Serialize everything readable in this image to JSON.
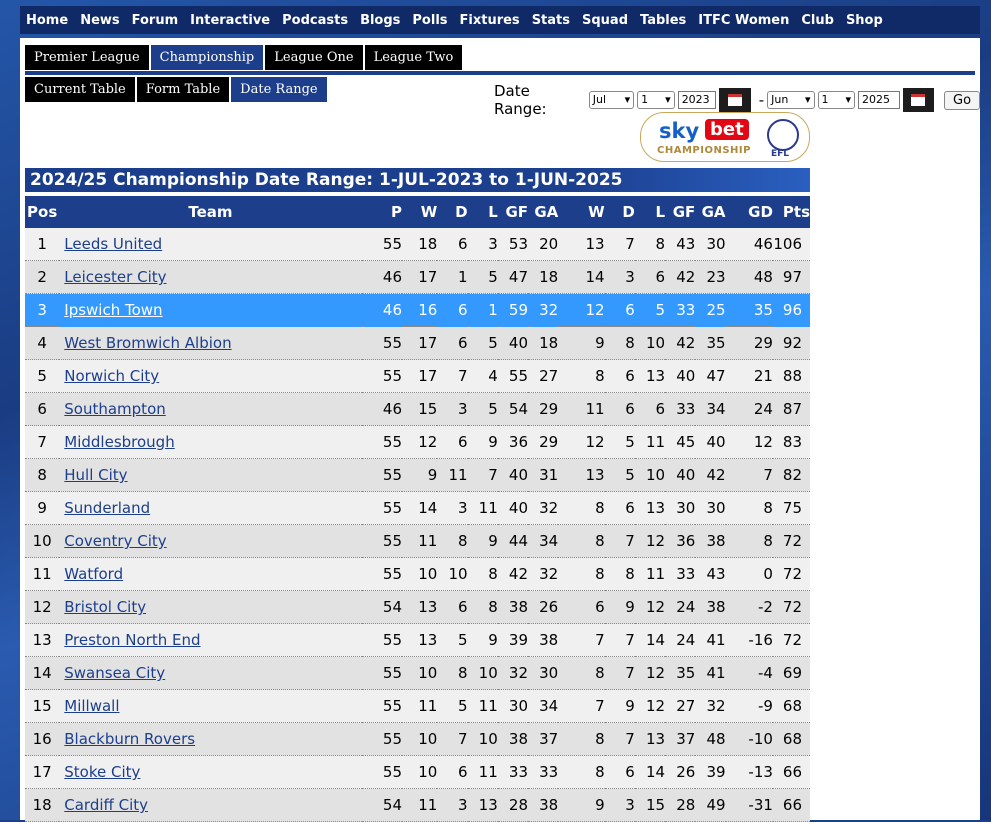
{
  "nav": [
    "Home",
    "News",
    "Forum",
    "Interactive",
    "Podcasts",
    "Blogs",
    "Polls",
    "Fixtures",
    "Stats",
    "Squad",
    "Tables",
    "ITFC Women",
    "Club",
    "Shop"
  ],
  "league_tabs": [
    {
      "label": "Premier League",
      "active": false
    },
    {
      "label": "Championship",
      "active": true
    },
    {
      "label": "League One",
      "active": false
    },
    {
      "label": "League Two",
      "active": false
    }
  ],
  "view_tabs": [
    {
      "label": "Current Table",
      "active": false
    },
    {
      "label": "Form Table",
      "active": false
    },
    {
      "label": "Date Range",
      "active": true
    }
  ],
  "date_range": {
    "label": "Date Range:",
    "from_month": "Jul",
    "from_day": "1",
    "from_year": "2023",
    "separator": "-",
    "to_month": "Jun",
    "to_day": "1",
    "to_year": "2025",
    "go_label": "Go"
  },
  "logo": {
    "sky": "sky",
    "bet": "bet",
    "championship": "CHAMPIONSHIP",
    "efl": "EFL"
  },
  "table_title": "2024/25 Championship Date Range: 1-JUL-2023 to 1-JUN-2025",
  "columns": [
    "Pos",
    "Team",
    "P",
    "W",
    "D",
    "L",
    "GF",
    "GA",
    "W",
    "D",
    "L",
    "GF",
    "GA",
    "GD",
    "Pts"
  ],
  "rows": [
    [
      "1",
      "Leeds United",
      "55",
      "18",
      "6",
      "3",
      "53",
      "20",
      "13",
      "7",
      "8",
      "43",
      "30",
      "46",
      "106"
    ],
    [
      "2",
      "Leicester City",
      "46",
      "17",
      "1",
      "5",
      "47",
      "18",
      "14",
      "3",
      "6",
      "42",
      "23",
      "48",
      "97"
    ],
    [
      "3",
      "Ipswich Town",
      "46",
      "16",
      "6",
      "1",
      "59",
      "32",
      "12",
      "6",
      "5",
      "33",
      "25",
      "35",
      "96"
    ],
    [
      "4",
      "West Bromwich Albion",
      "55",
      "17",
      "6",
      "5",
      "40",
      "18",
      "9",
      "8",
      "10",
      "42",
      "35",
      "29",
      "92"
    ],
    [
      "5",
      "Norwich City",
      "55",
      "17",
      "7",
      "4",
      "55",
      "27",
      "8",
      "6",
      "13",
      "40",
      "47",
      "21",
      "88"
    ],
    [
      "6",
      "Southampton",
      "46",
      "15",
      "3",
      "5",
      "54",
      "29",
      "11",
      "6",
      "6",
      "33",
      "34",
      "24",
      "87"
    ],
    [
      "7",
      "Middlesbrough",
      "55",
      "12",
      "6",
      "9",
      "36",
      "29",
      "12",
      "5",
      "11",
      "45",
      "40",
      "12",
      "83"
    ],
    [
      "8",
      "Hull City",
      "55",
      "9",
      "11",
      "7",
      "40",
      "31",
      "13",
      "5",
      "10",
      "40",
      "42",
      "7",
      "82"
    ],
    [
      "9",
      "Sunderland",
      "55",
      "14",
      "3",
      "11",
      "40",
      "32",
      "8",
      "6",
      "13",
      "30",
      "30",
      "8",
      "75"
    ],
    [
      "10",
      "Coventry City",
      "55",
      "11",
      "8",
      "9",
      "44",
      "34",
      "8",
      "7",
      "12",
      "36",
      "38",
      "8",
      "72"
    ],
    [
      "11",
      "Watford",
      "55",
      "10",
      "10",
      "8",
      "42",
      "32",
      "8",
      "8",
      "11",
      "33",
      "43",
      "0",
      "72"
    ],
    [
      "12",
      "Bristol City",
      "54",
      "13",
      "6",
      "8",
      "38",
      "26",
      "6",
      "9",
      "12",
      "24",
      "38",
      "-2",
      "72"
    ],
    [
      "13",
      "Preston North End",
      "55",
      "13",
      "5",
      "9",
      "39",
      "38",
      "7",
      "7",
      "14",
      "24",
      "41",
      "-16",
      "72"
    ],
    [
      "14",
      "Swansea City",
      "55",
      "10",
      "8",
      "10",
      "32",
      "30",
      "8",
      "7",
      "12",
      "35",
      "41",
      "-4",
      "69"
    ],
    [
      "15",
      "Millwall",
      "55",
      "11",
      "5",
      "11",
      "30",
      "34",
      "7",
      "9",
      "12",
      "27",
      "32",
      "-9",
      "68"
    ],
    [
      "16",
      "Blackburn Rovers",
      "55",
      "10",
      "7",
      "10",
      "38",
      "37",
      "8",
      "7",
      "13",
      "37",
      "48",
      "-10",
      "68"
    ],
    [
      "17",
      "Stoke City",
      "55",
      "10",
      "6",
      "11",
      "33",
      "33",
      "8",
      "6",
      "14",
      "26",
      "39",
      "-13",
      "66"
    ],
    [
      "18",
      "Cardiff City",
      "54",
      "11",
      "3",
      "13",
      "28",
      "38",
      "9",
      "3",
      "15",
      "28",
      "49",
      "-31",
      "66"
    ]
  ],
  "highlight_team": "Ipswich Town",
  "colors": {
    "navy": "#1d3f8b",
    "highlight": "#3399ff"
  }
}
